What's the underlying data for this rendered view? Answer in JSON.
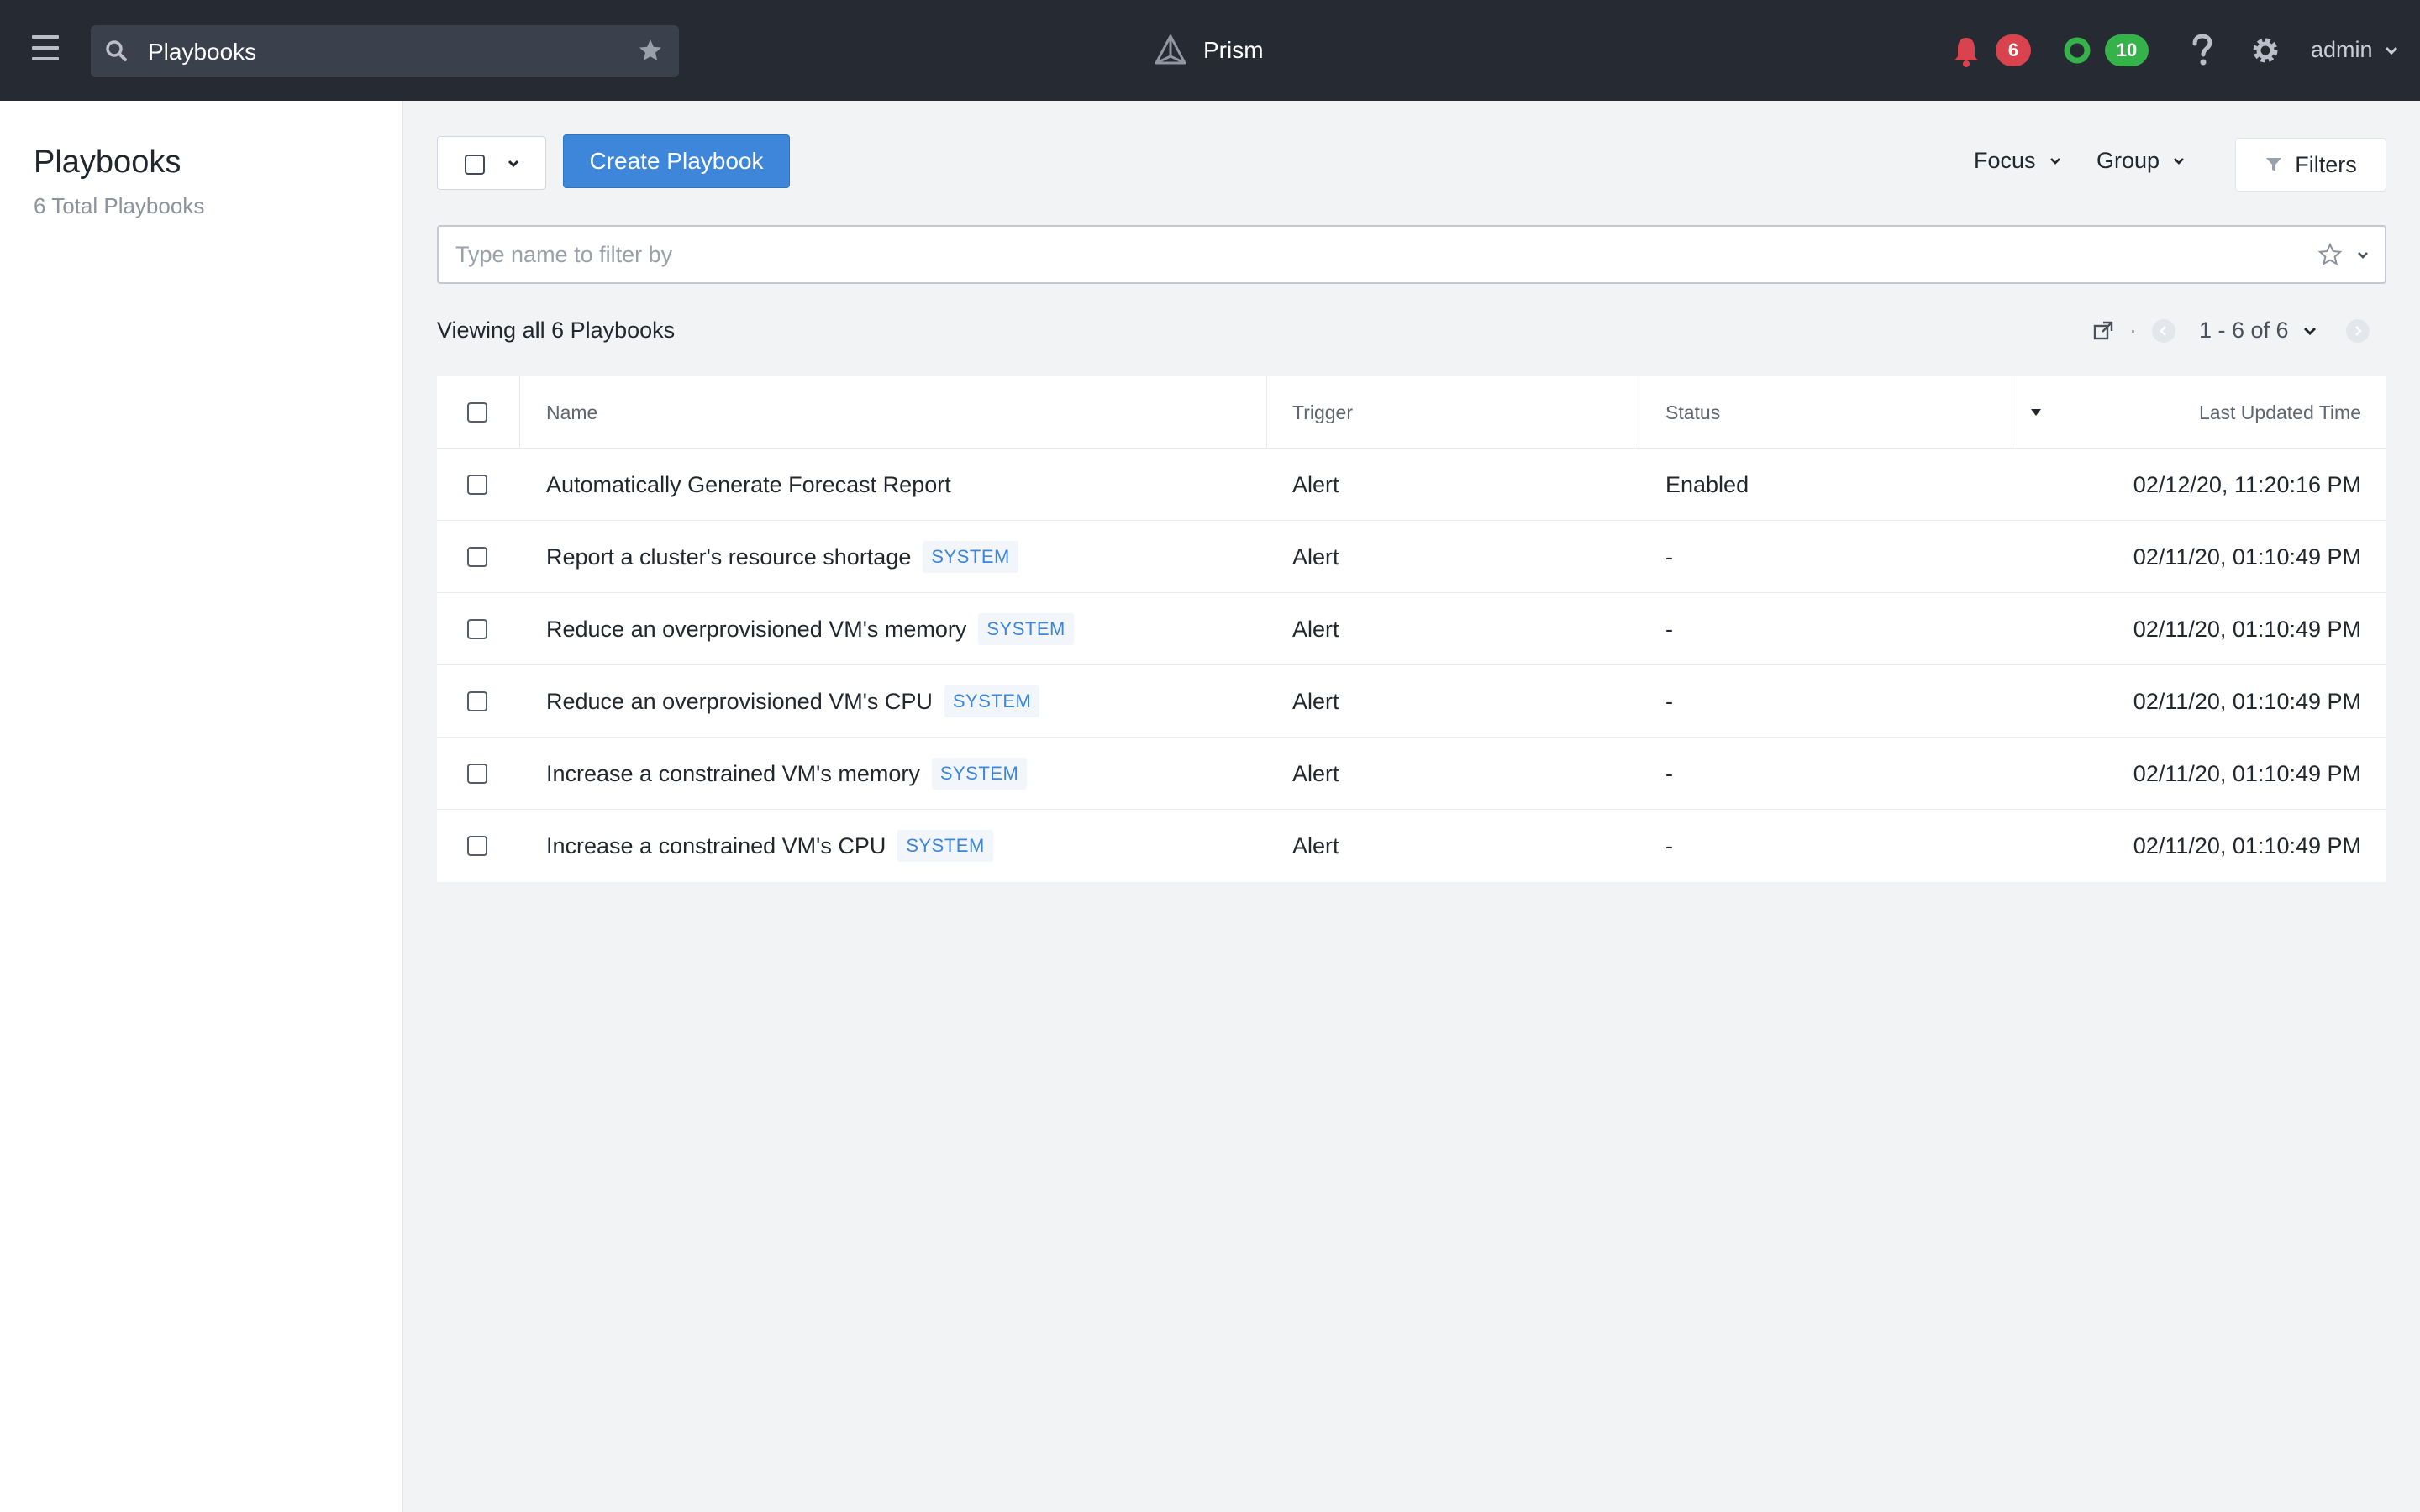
{
  "topbar": {
    "search_value": "Playbooks",
    "brand_name": "Prism",
    "alerts_count": "6",
    "tasks_count": "10",
    "user_name": "admin",
    "colors": {
      "bar": "#252a33",
      "alert": "#d9434d",
      "ok": "#35b34a"
    }
  },
  "leftpanel": {
    "title": "Playbooks",
    "subtitle": "6 Total Playbooks"
  },
  "toolbar": {
    "create_label": "Create Playbook",
    "focus_label": "Focus",
    "group_label": "Group",
    "filters_label": "Filters",
    "filter_placeholder": "Type name to filter by"
  },
  "listinfo": {
    "viewing_text": "Viewing all 6 Playbooks",
    "range_text": "1 - 6 of 6"
  },
  "table": {
    "headers": {
      "name": "Name",
      "trigger": "Trigger",
      "status": "Status",
      "last_updated": "Last Updated Time"
    },
    "rows": [
      {
        "name": "Automatically Generate Forecast Report",
        "tag": "",
        "trigger": "Alert",
        "status": "Enabled",
        "time": "02/12/20, 11:20:16 PM"
      },
      {
        "name": "Report a cluster's resource shortage",
        "tag": "SYSTEM",
        "trigger": "Alert",
        "status": "-",
        "time": "02/11/20, 01:10:49 PM"
      },
      {
        "name": "Reduce an overprovisioned VM's memory",
        "tag": "SYSTEM",
        "trigger": "Alert",
        "status": "-",
        "time": "02/11/20, 01:10:49 PM"
      },
      {
        "name": "Reduce an overprovisioned VM's CPU",
        "tag": "SYSTEM",
        "trigger": "Alert",
        "status": "-",
        "time": "02/11/20, 01:10:49 PM"
      },
      {
        "name": "Increase a constrained VM's memory",
        "tag": "SYSTEM",
        "trigger": "Alert",
        "status": "-",
        "time": "02/11/20, 01:10:49 PM"
      },
      {
        "name": "Increase a constrained VM's CPU",
        "tag": "SYSTEM",
        "trigger": "Alert",
        "status": "-",
        "time": "02/11/20, 01:10:49 PM"
      }
    ]
  }
}
